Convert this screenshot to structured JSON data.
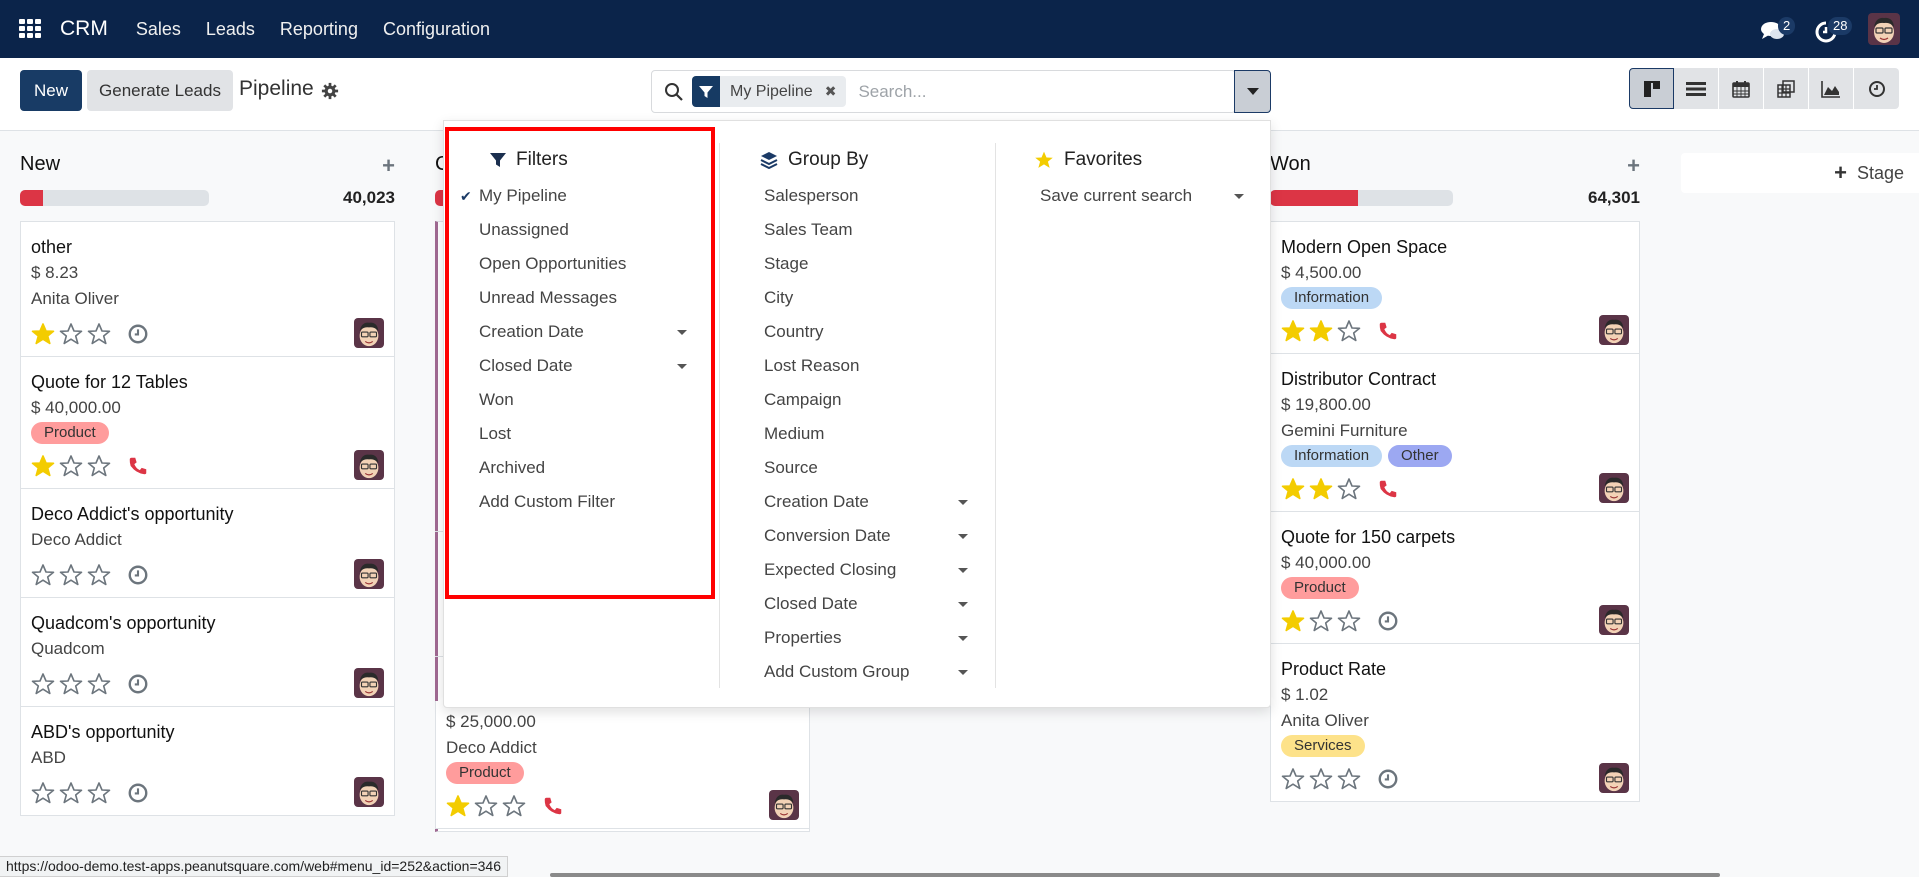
{
  "navbar": {
    "brand": "CRM",
    "menu": [
      "Sales",
      "Leads",
      "Reporting",
      "Configuration"
    ],
    "messages_count": "2",
    "activities_count": "28"
  },
  "control_panel": {
    "new_label": "New",
    "generate_leads_label": "Generate Leads",
    "title": "Pipeline",
    "search": {
      "facet_label": "My Pipeline",
      "placeholder": "Search...",
      "value": ""
    },
    "views": [
      "kanban",
      "list",
      "calendar",
      "pivot",
      "graph",
      "activity"
    ]
  },
  "dropdown": {
    "filters": {
      "title": "Filters",
      "items": [
        {
          "label": "My Pipeline",
          "checked": true,
          "submenu": false
        },
        {
          "label": "Unassigned",
          "checked": false,
          "submenu": false
        },
        {
          "label": "Open Opportunities",
          "checked": false,
          "submenu": false
        },
        {
          "label": "Unread Messages",
          "checked": false,
          "submenu": false
        },
        {
          "label": "Creation Date",
          "checked": false,
          "submenu": true
        },
        {
          "label": "Closed Date",
          "checked": false,
          "submenu": true
        },
        {
          "label": "Won",
          "checked": false,
          "submenu": false
        },
        {
          "label": "Lost",
          "checked": false,
          "submenu": false
        },
        {
          "label": "Archived",
          "checked": false,
          "submenu": false
        },
        {
          "label": "Add Custom Filter",
          "checked": false,
          "submenu": false
        }
      ]
    },
    "group_by": {
      "title": "Group By",
      "items": [
        {
          "label": "Salesperson",
          "submenu": false
        },
        {
          "label": "Sales Team",
          "submenu": false
        },
        {
          "label": "Stage",
          "submenu": false
        },
        {
          "label": "City",
          "submenu": false
        },
        {
          "label": "Country",
          "submenu": false
        },
        {
          "label": "Lost Reason",
          "submenu": false
        },
        {
          "label": "Campaign",
          "submenu": false
        },
        {
          "label": "Medium",
          "submenu": false
        },
        {
          "label": "Source",
          "submenu": false
        },
        {
          "label": "Creation Date",
          "submenu": true
        },
        {
          "label": "Conversion Date",
          "submenu": true
        },
        {
          "label": "Expected Closing",
          "submenu": true
        },
        {
          "label": "Closed Date",
          "submenu": true
        },
        {
          "label": "Properties",
          "submenu": true
        },
        {
          "label": "Add Custom Group",
          "submenu": true
        }
      ]
    },
    "favorites": {
      "title": "Favorites",
      "items": [
        {
          "label": "Save current search",
          "submenu": true
        }
      ]
    }
  },
  "columns": [
    {
      "title": "New",
      "total": "40,023",
      "progress_fraction": 0.12,
      "cards": [
        {
          "name": "other",
          "lines": [
            "$ 8.23",
            "Anita Oliver"
          ],
          "tags": [],
          "stars": 1,
          "activity": "clock"
        },
        {
          "name": "Quote for 12 Tables",
          "lines": [
            "$ 40,000.00"
          ],
          "tags": [
            {
              "label": "Product",
              "color": "#ff9c9c"
            }
          ],
          "stars": 1,
          "activity": "phone"
        },
        {
          "name": "Deco Addict's opportunity",
          "lines": [
            "Deco Addict"
          ],
          "tags": [],
          "stars": 0,
          "activity": "clock"
        },
        {
          "name": "Quadcom's opportunity",
          "lines": [
            "Quadcom"
          ],
          "tags": [],
          "stars": 0,
          "activity": "clock"
        },
        {
          "name": "ABD's opportunity",
          "lines": [
            "ABD"
          ],
          "tags": [],
          "stars": 0,
          "activity": "clock"
        }
      ]
    },
    {
      "title": "C",
      "partial_card": {
        "lines": [
          "$ 25,000.00",
          "Deco Addict"
        ],
        "tags": [
          {
            "label": "Product",
            "color": "#ff9c9c"
          }
        ],
        "stars": 1,
        "activity": "phone"
      }
    },
    {
      "title": "Won",
      "total": "64,301",
      "progress_fraction": 0.48,
      "cards": [
        {
          "name": "Modern Open Space",
          "lines": [
            "$ 4,500.00"
          ],
          "tags": [
            {
              "label": "Information",
              "color": "#bcd8f5"
            }
          ],
          "stars": 2,
          "activity": "phone"
        },
        {
          "name": "Distributor Contract",
          "lines": [
            "$ 19,800.00",
            "Gemini Furniture"
          ],
          "tags": [
            {
              "label": "Information",
              "color": "#bcd8f5"
            },
            {
              "label": "Other",
              "color": "#9ca8f2"
            }
          ],
          "stars": 2,
          "activity": "phone"
        },
        {
          "name": "Quote for 150 carpets",
          "lines": [
            "$ 40,000.00"
          ],
          "tags": [
            {
              "label": "Product",
              "color": "#ff9c9c"
            }
          ],
          "stars": 1,
          "activity": "clock"
        },
        {
          "name": "Product Rate",
          "lines": [
            "$ 1.02",
            "Anita Oliver"
          ],
          "tags": [
            {
              "label": "Services",
              "color": "#fde28a"
            }
          ],
          "stars": 0,
          "activity": "clock"
        }
      ]
    }
  ],
  "add_stage_label": "Stage",
  "status_url": "https://odoo-demo.test-apps.peanutsquare.com/web#menu_id=252&action=346",
  "colors": {
    "navbar": "#0b244a",
    "primary": "#183b65",
    "danger": "#dc3545",
    "star": "#f3cc00",
    "highlight": "#ff0000"
  }
}
